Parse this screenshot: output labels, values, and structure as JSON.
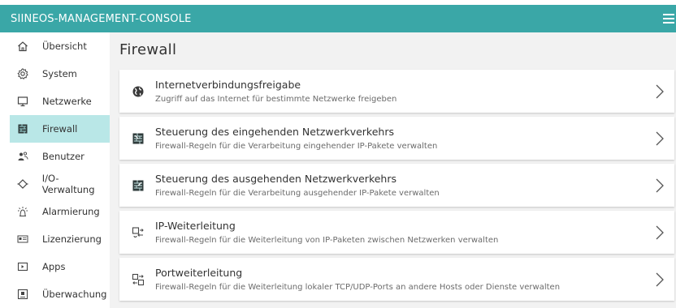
{
  "colors": {
    "header": "#3aa7a7",
    "active_nav": "#b9e7e7",
    "main_bg": "#f2f2f2"
  },
  "header": {
    "title": "SIINEOS-MANAGEMENT-CONSOLE",
    "menu_icon": "hamburger-icon"
  },
  "sidebar": {
    "items": [
      {
        "label": "Übersicht",
        "icon": "home-icon"
      },
      {
        "label": "System",
        "icon": "gear-icon"
      },
      {
        "label": "Netzwerke",
        "icon": "monitor-icon"
      },
      {
        "label": "Firewall",
        "icon": "firewall-icon",
        "active": true
      },
      {
        "label": "Benutzer",
        "icon": "users-icon"
      },
      {
        "label": "I/O-Verwaltung",
        "icon": "io-icon"
      },
      {
        "label": "Alarmierung",
        "icon": "alarm-icon"
      },
      {
        "label": "Lizenzierung",
        "icon": "license-icon"
      },
      {
        "label": "Apps",
        "icon": "apps-icon"
      },
      {
        "label": "Überwachung",
        "icon": "monitoring-icon"
      }
    ]
  },
  "main": {
    "title": "Firewall",
    "cards": [
      {
        "title": "Internetverbindungsfreigabe",
        "description": "Zugriff auf das Internet für bestimmte Netzwerke freigeben",
        "icon": "globe-icon"
      },
      {
        "title": "Steuerung des eingehenden Netzwerkverkehrs",
        "description": "Firewall-Regeln für die Verarbeitung eingehender IP-Pakete verwalten",
        "icon": "incoming-traffic-icon"
      },
      {
        "title": "Steuerung des ausgehenden Netzwerkverkehrs",
        "description": "Firewall-Regeln für die Verarbeitung ausgehender IP-Pakete verwalten",
        "icon": "outgoing-traffic-icon"
      },
      {
        "title": "IP-Weiterleitung",
        "description": "Firewall-Regeln für die Weiterleitung von IP-Paketen zwischen Netzwerken verwalten",
        "icon": "ip-forwarding-icon"
      },
      {
        "title": "Portweiterleitung",
        "description": "Firewall-Regeln für die Weiterleitung lokaler TCP/UDP-Ports an andere Hosts oder Dienste verwalten",
        "icon": "port-forwarding-icon"
      }
    ]
  }
}
